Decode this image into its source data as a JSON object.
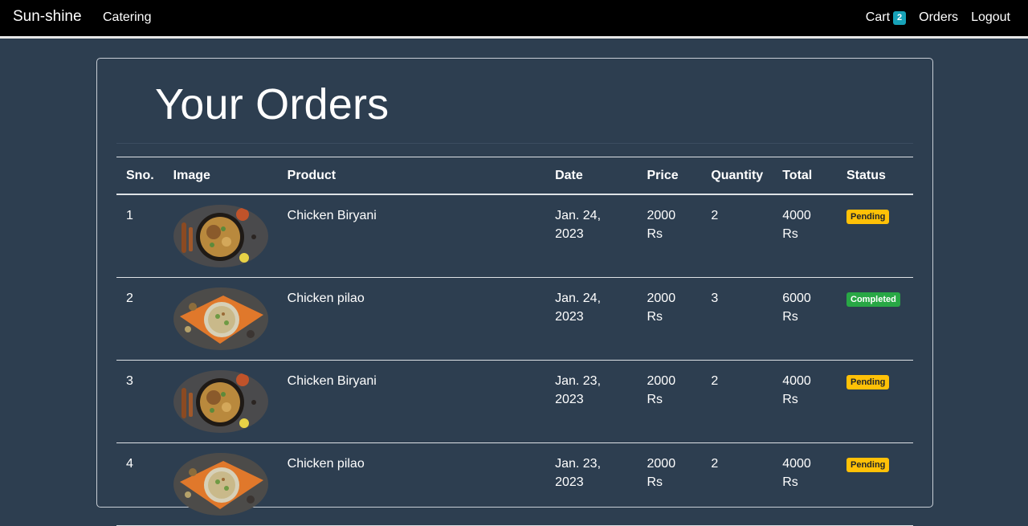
{
  "navbar": {
    "brand": "Sun-shine",
    "left_link": "Catering",
    "cart_label": "Cart",
    "cart_count": "2",
    "orders_label": "Orders",
    "logout_label": "Logout"
  },
  "page": {
    "title": "Your Orders"
  },
  "table": {
    "headers": [
      "Sno.",
      "Image",
      "Product",
      "Date",
      "Price",
      "Quantity",
      "Total",
      "Status"
    ],
    "rows": [
      {
        "sno": "1",
        "image": "biryani",
        "product": "Chicken Biryani",
        "date": "Jan. 24, 2023",
        "price": "2000 Rs",
        "quantity": "2",
        "total": "4000 Rs",
        "status": "Pending"
      },
      {
        "sno": "2",
        "image": "pilao",
        "product": "Chicken pilao",
        "date": "Jan. 24, 2023",
        "price": "2000 Rs",
        "quantity": "3",
        "total": "6000 Rs",
        "status": "Completed"
      },
      {
        "sno": "3",
        "image": "biryani",
        "product": "Chicken Biryani",
        "date": "Jan. 23, 2023",
        "price": "2000 Rs",
        "quantity": "2",
        "total": "4000 Rs",
        "status": "Pending"
      },
      {
        "sno": "4",
        "image": "pilao",
        "product": "Chicken pilao",
        "date": "Jan. 23, 2023",
        "price": "2000 Rs",
        "quantity": "2",
        "total": "4000 Rs",
        "status": "Pending"
      }
    ]
  },
  "colors": {
    "background": "#2d3e50",
    "navbar": "#000000",
    "cart_badge": "#17a2b8",
    "pending": "#ffc107",
    "completed": "#28a745"
  }
}
